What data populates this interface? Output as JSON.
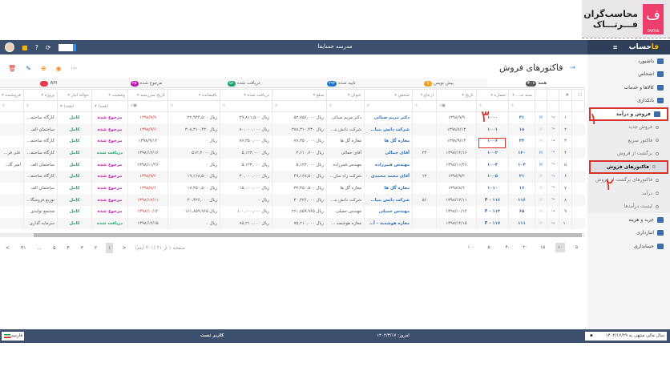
{
  "logo": {
    "line1": "محاسب‌گران",
    "line2": "فـــرتـــاک",
    "mark": "FARTAK"
  },
  "navbar": {
    "title": "مدرسه حسابفا",
    "brand": "حساب",
    "brand_suffix": "فا",
    "icons": [
      "avatar",
      "briefcase-icon",
      "help-icon",
      "refresh-icon"
    ]
  },
  "sidebar": {
    "items": [
      {
        "label": "داشبورد",
        "type": "main"
      },
      {
        "label": "اشخاص",
        "type": "main"
      },
      {
        "label": "کالاها و خدمات",
        "type": "main"
      },
      {
        "label": "بانکداری",
        "type": "main"
      },
      {
        "label": "فروش و درآمد",
        "type": "main",
        "highlight": true
      },
      {
        "label": "فروش جدید",
        "type": "sub"
      },
      {
        "label": "فاکتور سریع",
        "type": "sub"
      },
      {
        "label": "برگشت از فروش",
        "type": "sub"
      },
      {
        "label": "فاکتورهای فروش",
        "type": "sub",
        "active": true
      },
      {
        "label": "فاکتورهای برگشت از فروش",
        "type": "sub"
      },
      {
        "label": "درآمد",
        "type": "sub"
      },
      {
        "label": "لیست درآمدها",
        "type": "sub"
      },
      {
        "label": "خرید و هزینه",
        "type": "main"
      },
      {
        "label": "انبارداری",
        "type": "main"
      },
      {
        "label": "حسابداری",
        "type": "main"
      }
    ]
  },
  "page": {
    "title": "فاکتورهای فروش",
    "toolbar": [
      "delete-icon",
      "edit-icon",
      "add-icon",
      "view-icon",
      "more-icon"
    ],
    "more": "···"
  },
  "tabs": [
    {
      "label": "همه",
      "count": "۴۰۱",
      "color": "#555555"
    },
    {
      "label": "پیش نویس",
      "count": "۵",
      "color": "#f0a020"
    },
    {
      "label": "تایید شده",
      "count": "۲۹۳",
      "color": "#1e78c8"
    },
    {
      "label": "دریافت شده",
      "count": "۵۶",
      "color": "#1ba36b"
    },
    {
      "label": "مرجوع شده",
      "count": "۲۵",
      "color": "#c21bb6"
    },
    {
      "label": "API",
      "count": "۰",
      "color": "#e53950"
    }
  ],
  "table": {
    "columns": [
      "#",
      "",
      "",
      "سند حـ...",
      "شماره",
      "تاریخ",
      "ارجاع",
      "شخص",
      "عنوان",
      "مبلغ",
      "دریافت شده",
      "باقیمانده",
      "تاریخ سررسید",
      "وضعیت",
      "حواله انبار",
      "پروژه",
      "فروشنده"
    ],
    "filter_all": "(همه)",
    "currency": "ریال",
    "rows": [
      [
        "۱",
        "۴۱",
        "۱۰۰۰",
        "۱۳۹۸/۹/۹",
        "",
        "دکتر مریم صبائی",
        "دکتر مریم صبائی",
        "۵۲,۷۵۶,۰۰۰",
        "۲۹,۸۱۱,۵۰۰",
        "۲۲,۹۴۴,۵۰۰",
        "۱۳۹۸/۹/۹",
        "مرجوع شده",
        "کامل",
        "کارگاه ساختما...",
        ""
      ],
      [
        "۲",
        "۱۸",
        "۱۰۰۱",
        "۱۳۹۸/۸/۱۳",
        "",
        "شرکت دانش بنیان ۰۰",
        "شرکت دانش بنیا...",
        "۳۸۸,۳۱۰,۴۳۰",
        "۸۰,۰۰۰,۰۰۰",
        "۳۰۸,۳۱۰,۴۳۰",
        "۱۳۹۸/۹/۶",
        "مرجوع شده",
        "کامل",
        "ساختمان الف",
        ""
      ],
      [
        "۳",
        "۴۴",
        "۱۰۰۶",
        "۱۳۹۸/۹/۱۴",
        "",
        "مغازه گل ها",
        "مغازه گل ها",
        "۷۷,۳۵۰,۰۰۰",
        "۷۷,۳۵۰,۰۰۰",
        "۰",
        "۱۳۹۸/۹/۱۴",
        "مرجوع شده",
        "کامل",
        "کارگاه ساختما...",
        ""
      ],
      [
        "۴",
        "۱۲۰",
        "۱۰۰۳",
        "۱۳۹۸/۱۲/۱۶",
        "۲۳",
        "آقای جمالی",
        "آقای جمالی",
        "۴,۶۱۰,۷۰۰",
        "۵,۱۲۳,۰۰۰",
        "-۵۱۲,۳۰۰",
        "۱۳۹۸/۱۲/۱۶",
        "دریافت شده",
        "کامل",
        "کارگاه ساختما...",
        "علی فرخ نژ..."
      ],
      [
        "۵",
        "۱۰۳",
        "۱۰۰۴",
        "۱۳۹۸/۱۱/۲۶",
        "",
        "مهندس قنبرزاده",
        "مهندس قنبرزاده",
        "۵,۱۲۳,۰۰۰",
        "۵,۱۲۳,۰۰۰",
        "۰",
        "۱۳۹۸/۱۱/۲۶",
        "مرجوع شده",
        "کامل",
        "ساختمان الف",
        "امیر گلکاری"
      ],
      [
        "۶",
        "۳۱",
        "۱۰۰۵",
        "۱۳۹۸/۹/۲",
        "۱۳",
        "آقای محمد محمدی",
        "شرکت راه سازان ...",
        "۴۹,۱۶۸,۵۰۰",
        "۳۰,۰۰۰,۰۰۰",
        "۱۹,۱۶۸,۵۰۰",
        "۱۳۹۸/۹/۲",
        "مرجوع شده",
        "کامل",
        "کارگاه ساختما...",
        ""
      ],
      [
        "۷",
        "۱۶",
        "۱۰۱۰",
        "۱۳۹۸/۸/۶",
        "",
        "مغازه گل ها",
        "مغازه گل ها",
        "۳۲,۴۵۰,۵۰۰",
        "۱۵,۰۰۰,۰۰۰",
        "۱۷,۴۵۰,۵۰۰",
        "۱۳۹۸/۸/۶",
        "مرجوع شده",
        "کامل",
        "ساختمان الف",
        ""
      ],
      [
        "۸",
        "۱۱۶",
        "F - ۱۱۶",
        "۱۳۹۸/۱۲/۱۱",
        "۵۶",
        "شرکت دانش بنیان ۰۰",
        "شرکت دانش بنیا...",
        "۴۰,۴۲۶,۰۰۰",
        "۰",
        "۴۰,۴۲۶,۰۰۰",
        "۱۳۹۸/۱۲/۱۱",
        "مرجوع شده",
        "کامل",
        "توزیع فروشگا...",
        ""
      ],
      [
        "۹",
        "۶۵",
        "F - ۱۱۳",
        "۱۳۹۸/۱۰/۱۲",
        "",
        "مهندس جمیلی",
        "مهندس جمیلی",
        "۲۶۱,۸۵۹,۹۶۵",
        "۱۰۰,۰۰۰,۰۰۰",
        "۱۶۱,۸۵۹,۹۶۵",
        "۱۳۹۸/۱۰/۱۲",
        "مرجوع شده",
        "کامل",
        "مجتمع تولیدی",
        ""
      ],
      [
        "۱۰",
        "۱۱۱",
        "F - ۱۱۷",
        "۱۳۹۸/۱۲/۱۵",
        "",
        "مغازه هوشمند - آقای",
        "مغازه هوشمند - ...",
        "۷۵,۲۱۰,۰۰۰",
        "۷۵,۲۱۰,۰۰۰",
        "۰",
        "۱۳۹۸/۱۲/۱۵",
        "دریافت شده",
        "کامل",
        "سرمایه گذاری",
        ""
      ]
    ],
    "overdue_rows": [
      0,
      1,
      5,
      6,
      7,
      8
    ]
  },
  "pagination": {
    "pages": [
      "۱",
      "۲",
      "۳",
      "۴",
      "۵",
      "...",
      "۴۱"
    ],
    "current": "۱",
    "summary": "صفحه ۱ از ۴۱ (۴۰۱ آیتم)",
    "sizes": [
      "۵",
      "۱۰",
      "۱۵",
      "۲۰",
      "۳۰",
      "۵۰",
      "۱۰۰"
    ],
    "current_size": "۱۰"
  },
  "footer": {
    "fiscal_year": "سال مالی منتهی به ۱۴۰۲/۱۲/۲۹",
    "today": "امروز: ۱۴۰۲/۳/۱۷",
    "user": "کاربر تست",
    "language": "فارسی"
  },
  "annotations": [
    "۱",
    "۲",
    "۳"
  ],
  "colors": {
    "navbar": "#3c4f6d",
    "accent": "#2a6db5",
    "returned": "#c21bb6",
    "received": "#1ba36b",
    "overdue": "#d9342b",
    "annotation": "#d9342b"
  }
}
